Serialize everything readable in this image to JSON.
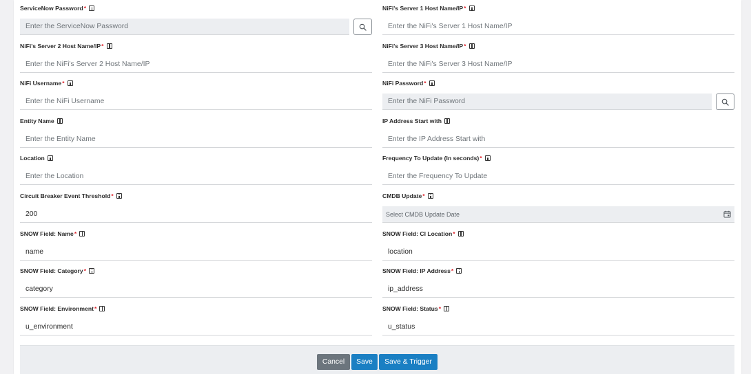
{
  "form": {
    "fields": [
      {
        "id": "servicenow-password",
        "label": "ServiceNow Password",
        "required": true,
        "placeholder": "Enter the ServiceNow Password",
        "value": "",
        "gray": true,
        "search_button": true,
        "col": "left",
        "row": 0
      },
      {
        "id": "nifi-server1-host",
        "label": "NiFi's Server 1 Host Name/IP",
        "required": true,
        "placeholder": "Enter the NiFi's Server 1 Host Name/IP",
        "value": "",
        "col": "right",
        "row": 0
      },
      {
        "id": "nifi-server2-host",
        "label": "NiFi's Server 2 Host Name/IP",
        "required": true,
        "placeholder": "Enter the NiFi's Server 2 Host Name/IP",
        "value": "",
        "col": "left",
        "row": 1
      },
      {
        "id": "nifi-server3-host",
        "label": "NiFi's Server 3 Host Name/IP",
        "required": true,
        "placeholder": "Enter the NiFi's Server 3 Host Name/IP",
        "value": "",
        "col": "right",
        "row": 1
      },
      {
        "id": "nifi-username",
        "label": "NiFi Username",
        "required": true,
        "placeholder": "Enter the NiFi Username",
        "value": "",
        "col": "left",
        "row": 2
      },
      {
        "id": "nifi-password",
        "label": "NiFi Password",
        "required": true,
        "placeholder": "Enter the NiFi Password",
        "value": "",
        "gray": true,
        "search_button": true,
        "col": "right",
        "row": 2
      },
      {
        "id": "entity-name",
        "label": "Entity Name",
        "required": false,
        "placeholder": "Enter the Entity Name",
        "value": "",
        "col": "left",
        "row": 3
      },
      {
        "id": "ip-address-start",
        "label": "IP Address Start with",
        "required": false,
        "placeholder": "Enter the IP Address Start with",
        "value": "",
        "col": "right",
        "row": 3
      },
      {
        "id": "location",
        "label": "Location",
        "required": false,
        "placeholder": "Enter the Location",
        "value": "",
        "col": "left",
        "row": 4
      },
      {
        "id": "frequency-to-update",
        "label": "Frequency To Update (In seconds)",
        "required": true,
        "placeholder": "Enter the Frequency To Update",
        "value": "",
        "col": "right",
        "row": 4
      },
      {
        "id": "circuit-breaker-threshold",
        "label": "Circuit Breaker Event Threshold",
        "required": true,
        "placeholder": "",
        "value": "200",
        "col": "left",
        "row": 5
      },
      {
        "id": "cmdb-update",
        "label": "CMDB Update",
        "required": true,
        "placeholder": "Select CMDB Update Date",
        "value": "",
        "date": true,
        "col": "right",
        "row": 5
      },
      {
        "id": "snow-field-name",
        "label": "SNOW Field: Name",
        "required": true,
        "placeholder": "",
        "value": "name",
        "col": "left",
        "row": 6
      },
      {
        "id": "snow-field-ci-location",
        "label": "SNOW Field: CI Location",
        "required": true,
        "placeholder": "",
        "value": "location",
        "col": "right",
        "row": 6
      },
      {
        "id": "snow-field-category",
        "label": "SNOW Field: Category",
        "required": true,
        "placeholder": "",
        "value": "category",
        "col": "left",
        "row": 7
      },
      {
        "id": "snow-field-ip-address",
        "label": "SNOW Field: IP Address",
        "required": true,
        "placeholder": "",
        "value": "ip_address",
        "col": "right",
        "row": 7
      },
      {
        "id": "snow-field-environment",
        "label": "SNOW Field: Environment",
        "required": true,
        "placeholder": "",
        "value": "u_environment",
        "col": "left",
        "row": 8
      },
      {
        "id": "snow-field-status",
        "label": "SNOW Field: Status",
        "required": true,
        "placeholder": "",
        "value": "u_status",
        "col": "right",
        "row": 8
      }
    ],
    "required_marker": "*"
  },
  "footer": {
    "cancel_label": "Cancel",
    "save_label": "Save",
    "save_trigger_label": "Save & Trigger"
  },
  "colors": {
    "required": "#e0262f",
    "primary": "#1a7fc3",
    "secondary": "#6c757d"
  },
  "icons": {
    "field_info": "info-icon",
    "field_search": "search-icon",
    "date_picker": "calendar-icon"
  }
}
